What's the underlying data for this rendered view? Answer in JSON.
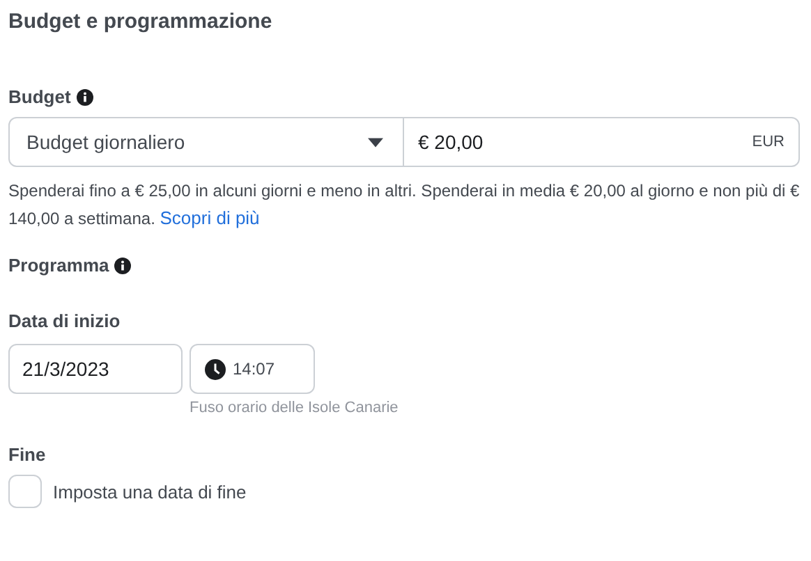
{
  "section_title": "Budget e programmazione",
  "budget": {
    "label": "Budget",
    "type_select": {
      "value": "Budget giornaliero"
    },
    "amount": {
      "value": "€ 20,00",
      "currency": "EUR"
    },
    "description": "Spenderai fino a € 25,00 in alcuni giorni e meno in altri. Spenderai in media € 20,00 al giorno e non più di € 140,00 a settimana.",
    "link": "Scopri di più"
  },
  "schedule": {
    "label": "Programma",
    "start": {
      "label": "Data di inizio",
      "date": "21/3/2023",
      "time": "14:07",
      "timezone": "Fuso orario delle Isole Canarie"
    },
    "end": {
      "label": "Fine",
      "checkbox_label": "Imposta una data di fine",
      "checked": false
    }
  }
}
